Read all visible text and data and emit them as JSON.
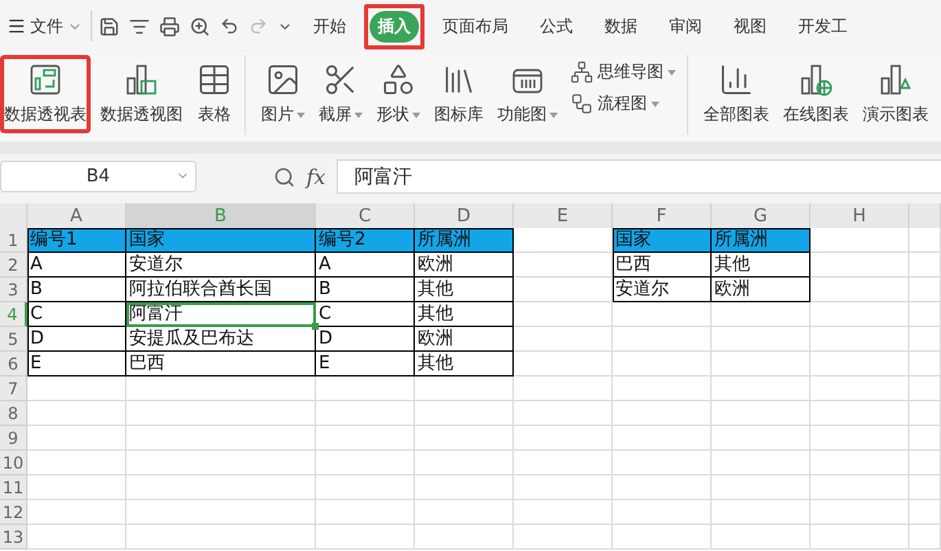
{
  "quick_access": {
    "menu_label": "文件"
  },
  "tabs": [
    {
      "label": "开始",
      "selected": false,
      "highlighted": false
    },
    {
      "label": "插入",
      "selected": true,
      "highlighted": true
    },
    {
      "label": "页面布局",
      "selected": false,
      "highlighted": false
    },
    {
      "label": "公式",
      "selected": false,
      "highlighted": false
    },
    {
      "label": "数据",
      "selected": false,
      "highlighted": false
    },
    {
      "label": "审阅",
      "selected": false,
      "highlighted": false
    },
    {
      "label": "视图",
      "selected": false,
      "highlighted": false
    },
    {
      "label": "开发工",
      "selected": false,
      "highlighted": false
    }
  ],
  "ribbon": {
    "groups": [
      {
        "items": [
          {
            "kind": "large",
            "label": "数据透视表",
            "dropdown": false,
            "highlighted": true
          },
          {
            "kind": "large",
            "label": "数据透视图",
            "dropdown": false,
            "highlighted": false
          },
          {
            "kind": "large",
            "label": "表格",
            "dropdown": false,
            "highlighted": false
          }
        ]
      },
      {
        "items": [
          {
            "kind": "large",
            "label": "图片",
            "dropdown": true,
            "highlighted": false
          },
          {
            "kind": "large",
            "label": "截屏",
            "dropdown": true,
            "highlighted": false
          },
          {
            "kind": "large",
            "label": "形状",
            "dropdown": true,
            "highlighted": false
          },
          {
            "kind": "large",
            "label": "图标库",
            "dropdown": false,
            "highlighted": false
          },
          {
            "kind": "large",
            "label": "功能图",
            "dropdown": true,
            "highlighted": false
          },
          {
            "kind": "stack",
            "items": [
              {
                "label": "思维导图",
                "dropdown": true
              },
              {
                "label": "流程图",
                "dropdown": true
              }
            ]
          }
        ]
      },
      {
        "items": [
          {
            "kind": "large",
            "label": "全部图表",
            "dropdown": false,
            "highlighted": false
          },
          {
            "kind": "large",
            "label": "在线图表",
            "dropdown": false,
            "highlighted": false
          },
          {
            "kind": "large",
            "label": "演示图表",
            "dropdown": false,
            "highlighted": false
          }
        ]
      }
    ]
  },
  "formula_bar": {
    "name_box": "B4",
    "function_label": "fx",
    "value": "阿富汗"
  },
  "sheet": {
    "columns": [
      {
        "label": "A",
        "selected": false
      },
      {
        "label": "B",
        "selected": true
      },
      {
        "label": "C",
        "selected": false
      },
      {
        "label": "D",
        "selected": false
      },
      {
        "label": "E",
        "selected": false
      },
      {
        "label": "F",
        "selected": false
      },
      {
        "label": "G",
        "selected": false
      },
      {
        "label": "H",
        "selected": false
      }
    ],
    "rows": [
      {
        "number": "1",
        "selected": false,
        "kind": "header",
        "cells": [
          {
            "text": "编号1",
            "selected": false
          },
          {
            "text": "国家",
            "selected": false
          },
          {
            "text": "编号2",
            "selected": false
          },
          {
            "text": "所属洲",
            "selected": false
          },
          null,
          {
            "text": "国家",
            "selected": false
          },
          {
            "text": "所属洲",
            "selected": false
          },
          null
        ]
      },
      {
        "number": "2",
        "selected": false,
        "kind": "data",
        "cells": [
          {
            "text": "A",
            "selected": false
          },
          {
            "text": "安道尔",
            "selected": false
          },
          {
            "text": "A",
            "selected": false
          },
          {
            "text": "欧洲",
            "selected": false
          },
          null,
          {
            "text": "巴西",
            "selected": false
          },
          {
            "text": "其他",
            "selected": false
          },
          null
        ]
      },
      {
        "number": "3",
        "selected": false,
        "kind": "data",
        "cells": [
          {
            "text": "B",
            "selected": false
          },
          {
            "text": "阿拉伯联合酋长国",
            "selected": false
          },
          {
            "text": "B",
            "selected": false
          },
          {
            "text": "其他",
            "selected": false
          },
          null,
          {
            "text": "安道尔",
            "selected": false
          },
          {
            "text": "欧洲",
            "selected": false
          },
          null
        ]
      },
      {
        "number": "4",
        "selected": true,
        "kind": "data",
        "cells": [
          {
            "text": "C",
            "selected": false
          },
          {
            "text": "阿富汗",
            "selected": true
          },
          {
            "text": "C",
            "selected": false
          },
          {
            "text": "其他",
            "selected": false
          },
          null,
          null,
          null,
          null
        ]
      },
      {
        "number": "5",
        "selected": false,
        "kind": "data",
        "cells": [
          {
            "text": "D",
            "selected": false
          },
          {
            "text": "安提瓜及巴布达",
            "selected": false
          },
          {
            "text": "D",
            "selected": false
          },
          {
            "text": "欧洲",
            "selected": false
          },
          null,
          null,
          null,
          null
        ]
      },
      {
        "number": "6",
        "selected": false,
        "kind": "data",
        "cells": [
          {
            "text": "E",
            "selected": false
          },
          {
            "text": "巴西",
            "selected": false
          },
          {
            "text": "E",
            "selected": false
          },
          {
            "text": "其他",
            "selected": false
          },
          null,
          null,
          null,
          null
        ]
      },
      {
        "number": "7",
        "selected": false,
        "kind": "data",
        "cells": [
          null,
          null,
          null,
          null,
          null,
          null,
          null,
          null
        ]
      },
      {
        "number": "8",
        "selected": false,
        "kind": "data",
        "cells": [
          null,
          null,
          null,
          null,
          null,
          null,
          null,
          null
        ]
      },
      {
        "number": "9",
        "selected": false,
        "kind": "data",
        "cells": [
          null,
          null,
          null,
          null,
          null,
          null,
          null,
          null
        ]
      },
      {
        "number": "10",
        "selected": false,
        "kind": "data",
        "cells": [
          null,
          null,
          null,
          null,
          null,
          null,
          null,
          null
        ]
      },
      {
        "number": "11",
        "selected": false,
        "kind": "data",
        "cells": [
          null,
          null,
          null,
          null,
          null,
          null,
          null,
          null
        ]
      },
      {
        "number": "12",
        "selected": false,
        "kind": "data",
        "cells": [
          null,
          null,
          null,
          null,
          null,
          null,
          null,
          null
        ]
      },
      {
        "number": "13",
        "selected": false,
        "kind": "data",
        "cells": [
          null,
          null,
          null,
          null,
          null,
          null,
          null,
          null
        ]
      }
    ]
  }
}
